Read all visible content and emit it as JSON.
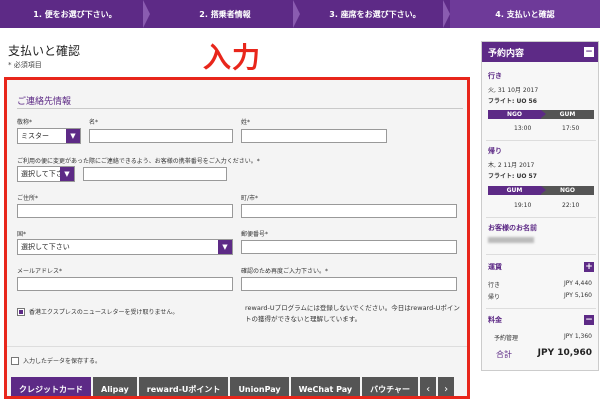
{
  "steps": [
    "1. 便をお選び下さい。",
    "2. 搭乗者情報",
    "3. 座席をお選び下さい。",
    "4. 支払いと確認"
  ],
  "page": {
    "title": "支払いと確認",
    "required_note": "* 必須項目",
    "overlay_label": "入力"
  },
  "contact": {
    "section_title": "ご連絡先情報",
    "title_label": "敬称*",
    "title_value": "ミスター",
    "first_name_label": "名*",
    "last_name_label": "姓*",
    "phone_label": "ご利用の便に変更があった際にご連絡できるよう、お客様の携帯番号をご入力ください。*",
    "phone_country_value": "選択して下さ",
    "address_label": "ご住所*",
    "city_label": "町/市*",
    "country_label": "国*",
    "country_value": "選択して下さい",
    "postal_label": "郵便番号*",
    "email_label": "メールアドレス*",
    "email_confirm_label": "確認のため再度ご入力下さい。*",
    "newsletter_label": "香港エクスプレスのニュースレターを受け取りません。",
    "reward_note": "reward-Uプログラムには登録しないでください。今日はreward-Uポイントの獲得ができないと理解しています。",
    "save_label": "入力したデータを保存する。"
  },
  "payment_tabs": [
    "クレジットカード",
    "Alipay",
    "reward-Uポイント",
    "UnionPay",
    "WeChat Pay",
    "バウチャー"
  ],
  "payment_nav": {
    "prev": "‹",
    "next": "›"
  },
  "summary": {
    "title": "予約内容",
    "collapse": "−",
    "outbound": {
      "label": "行き",
      "date": "火, 31 10月 2017",
      "flight": "フライト: UO 56",
      "from": "NGO",
      "to": "GUM",
      "dep": "13:00",
      "arr": "17:50"
    },
    "return": {
      "label": "帰り",
      "date": "木, 2 11月 2017",
      "flight": "フライト: UO 57",
      "from": "GUM",
      "to": "NGO",
      "dep": "19:10",
      "arr": "22:10"
    },
    "passenger_label": "お客様のお名前",
    "fare": {
      "label": "運賃",
      "toggle": "+",
      "outbound_label": "行き",
      "outbound_value": "JPY 4,440",
      "return_label": "帰り",
      "return_value": "JPY 5,160"
    },
    "fees": {
      "label": "料金",
      "toggle": "−",
      "mgmt_label": "予約管理",
      "mgmt_value": "JPY 1,360"
    },
    "total_label": "合計",
    "total_value": "JPY 10,960"
  },
  "colors": {
    "brand": "#5d2a86",
    "highlight": "#e8261b"
  }
}
